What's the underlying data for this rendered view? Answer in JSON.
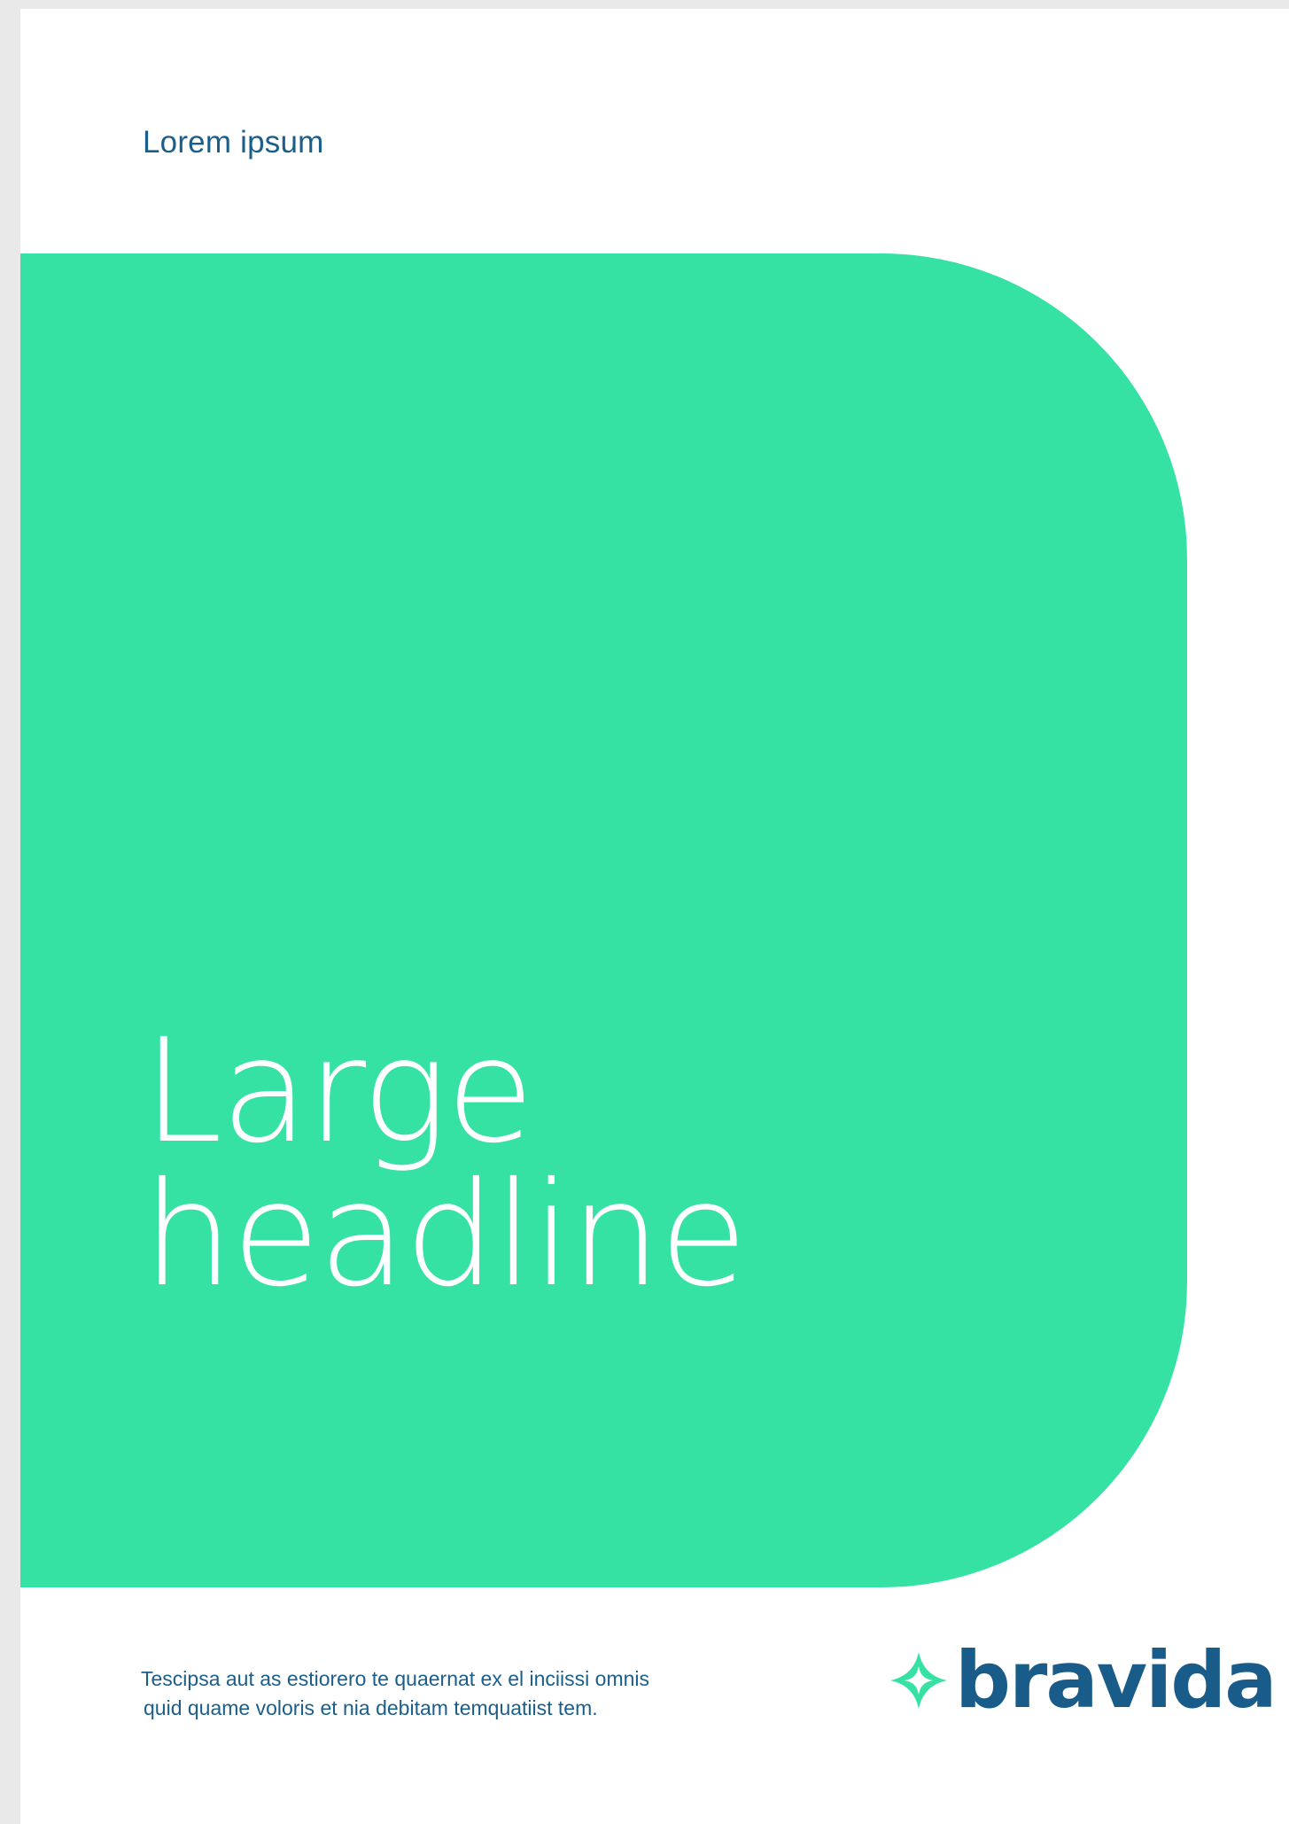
{
  "document": {
    "kicker": "Lorem ipsum",
    "headline": {
      "line1": "Large",
      "line2": "headline"
    },
    "footer": {
      "line1": "Tescipsa aut as estiorero te quaernat ex el inciissi omnis",
      "line2": "quid quame voloris et nia debitam temquatiist tem."
    }
  },
  "logo": {
    "wordmark": "bravida",
    "icon": "four-point-star-logo-icon"
  },
  "colors": {
    "accent_green": "#35e1a3",
    "brand_blue": "#1b5e8a",
    "page_background": "#ffffff",
    "outer_background": "#e9e9e9"
  }
}
